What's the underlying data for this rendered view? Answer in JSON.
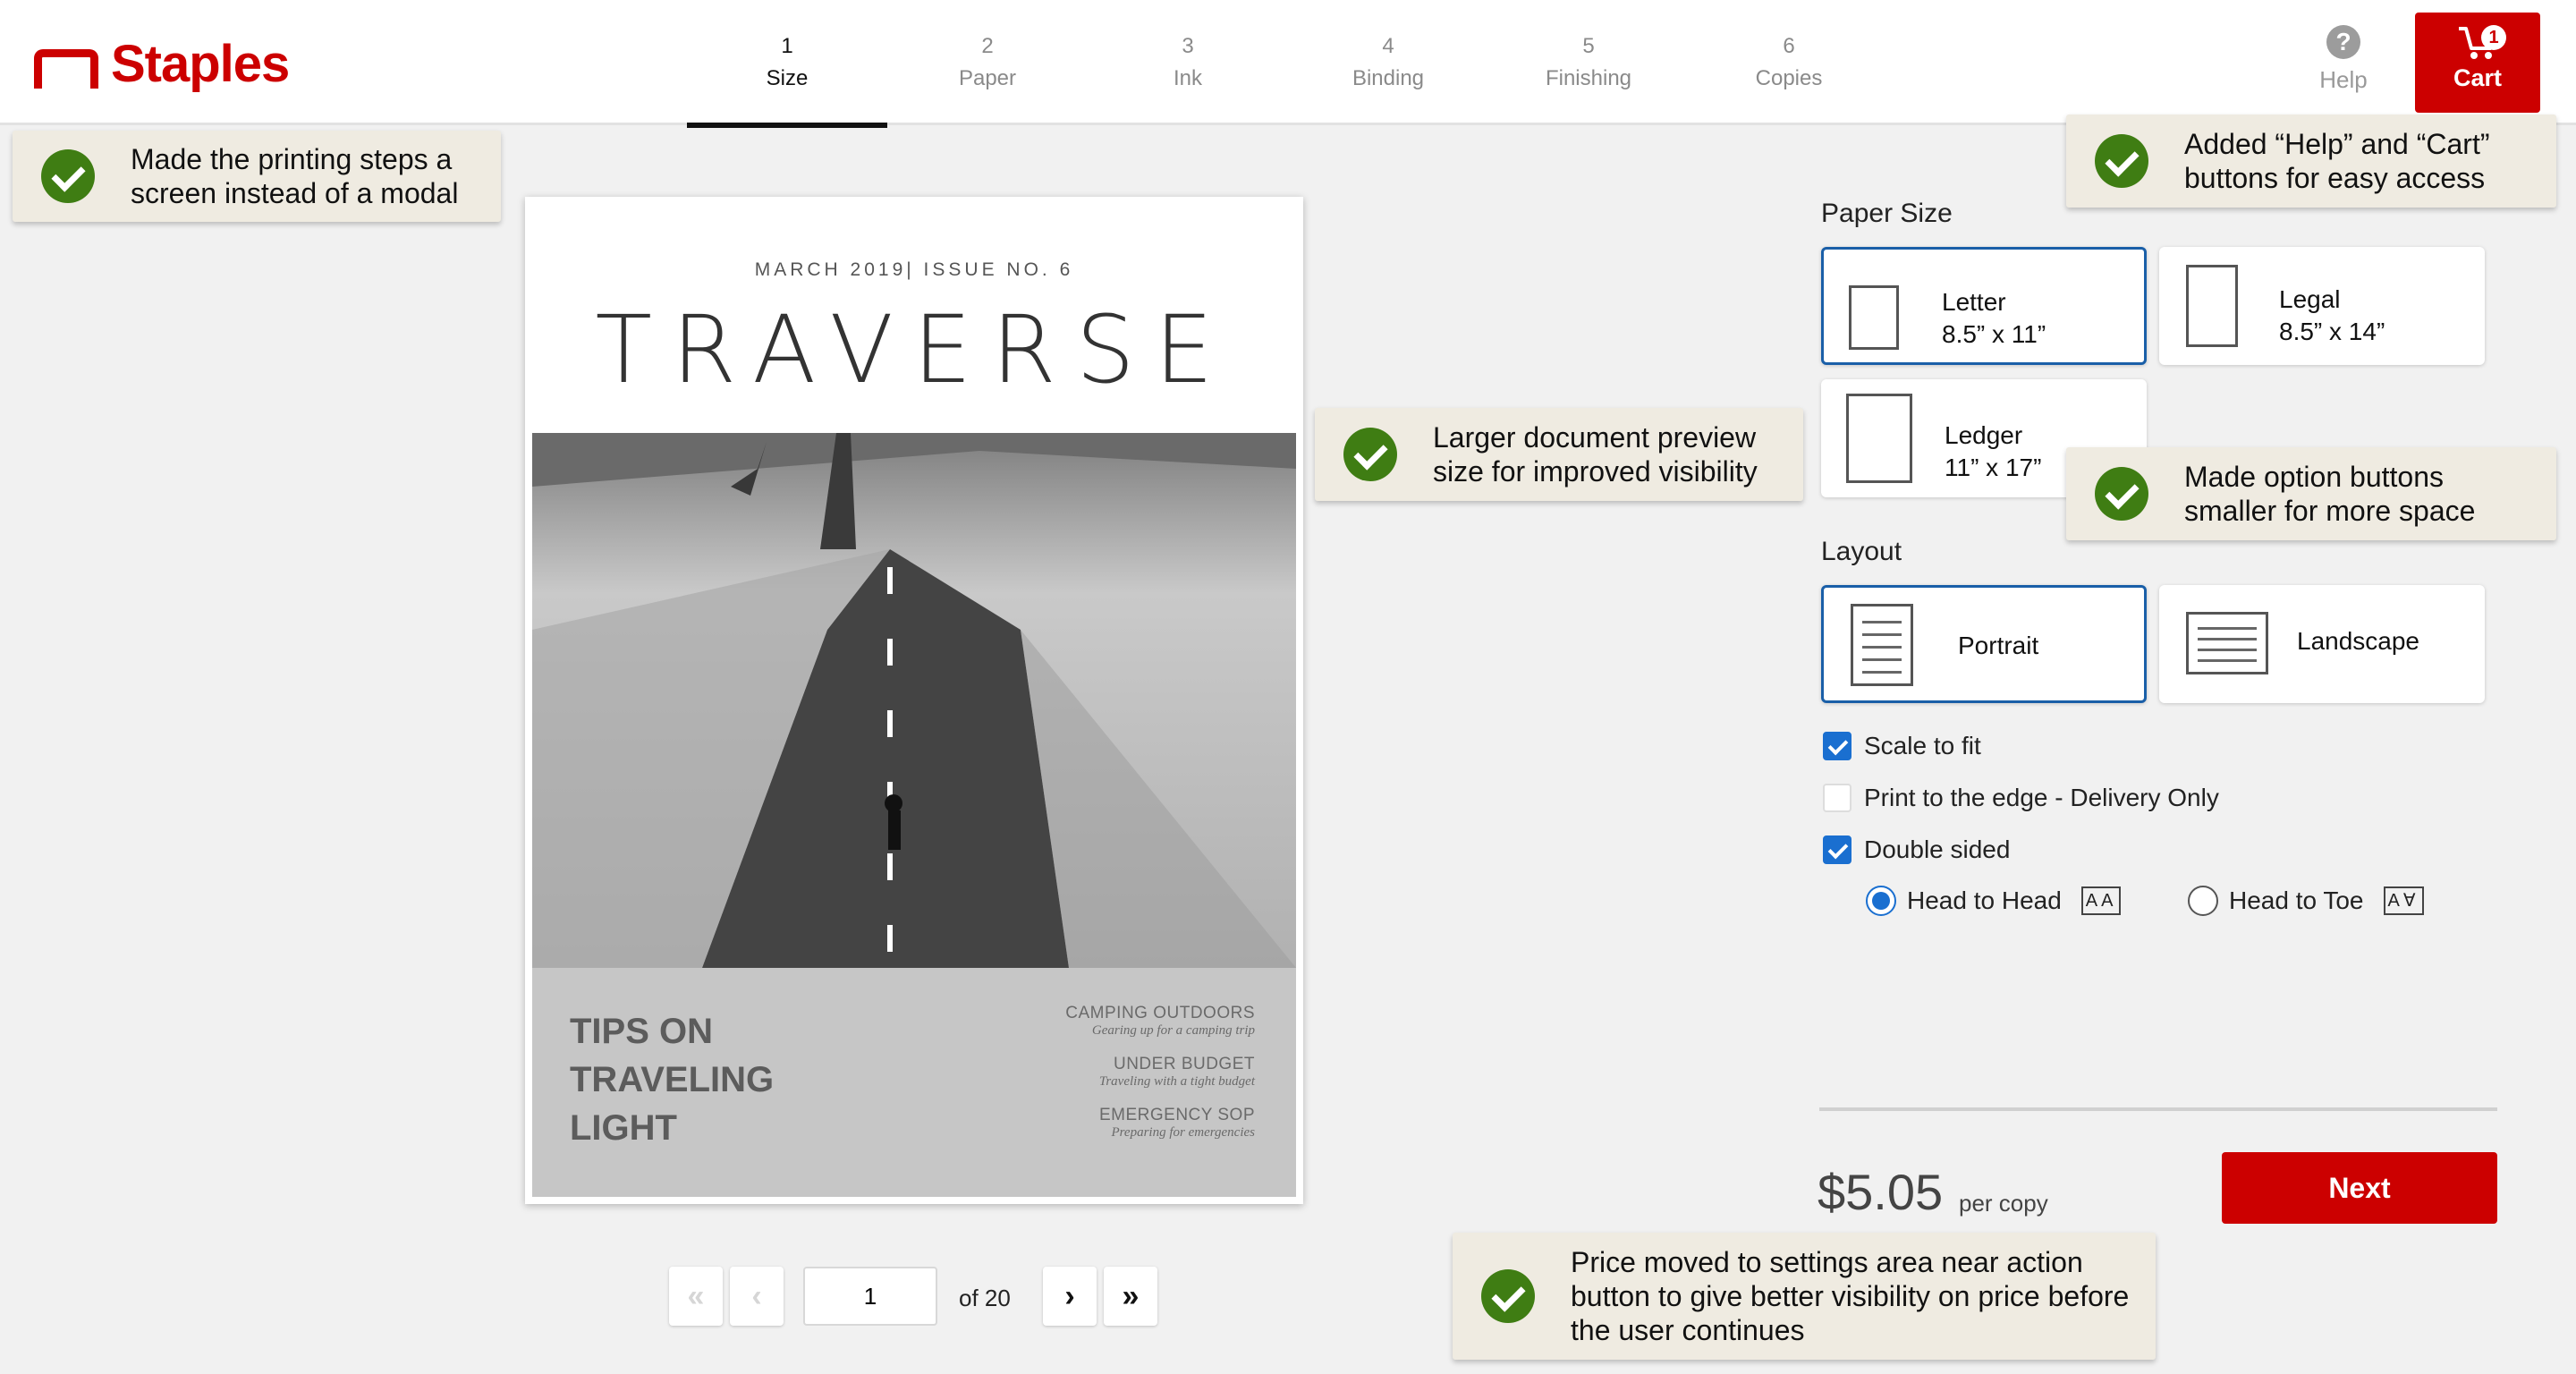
{
  "brand": {
    "name": "Staples",
    "color": "#cc0000"
  },
  "steps": [
    {
      "num": "1",
      "label": "Size"
    },
    {
      "num": "2",
      "label": "Paper"
    },
    {
      "num": "3",
      "label": "Ink"
    },
    {
      "num": "4",
      "label": "Binding"
    },
    {
      "num": "5",
      "label": "Finishing"
    },
    {
      "num": "6",
      "label": "Copies"
    }
  ],
  "header": {
    "help_label": "Help",
    "cart_label": "Cart",
    "cart_count": "1"
  },
  "notes": {
    "steps": "Made the printing steps a screen instead of a modal",
    "header_buttons": "Added “Help” and “Cart” buttons for easy access",
    "preview": "Larger document preview size for improved visibility",
    "options": "Made option buttons smaller for more space",
    "price": "Price moved to settings area near action button to give better visibility on price before the user continues"
  },
  "document": {
    "issue": "MARCH 2019| ISSUE NO. 6",
    "masthead": "TRAVERSE",
    "headline": [
      "TIPS ON",
      "TRAVELING",
      "LIGHT"
    ],
    "toc": [
      {
        "heading": "CAMPING OUTDOORS",
        "sub": "Gearing up for a camping trip"
      },
      {
        "heading": "UNDER BUDGET",
        "sub": "Traveling with a tight budget"
      },
      {
        "heading": "EMERGENCY SOP",
        "sub": "Preparing for emergencies"
      }
    ]
  },
  "pager": {
    "current": "1",
    "total_label": "of 20"
  },
  "settings": {
    "paper_size_title": "Paper Size",
    "paper_sizes": [
      {
        "name": "Letter",
        "dims": "8.5” x 11”",
        "selected": true
      },
      {
        "name": "Legal",
        "dims": "8.5” x 14”",
        "selected": false
      },
      {
        "name": "Ledger",
        "dims": "11” x 17”",
        "selected": false
      }
    ],
    "layout_title": "Layout",
    "layouts": [
      {
        "name": "Portrait",
        "selected": true
      },
      {
        "name": "Landscape",
        "selected": false
      }
    ],
    "checkboxes": [
      {
        "label": "Scale to fit",
        "checked": true
      },
      {
        "label": "Print to the edge - Delivery Only",
        "checked": false
      },
      {
        "label": "Double sided",
        "checked": true
      }
    ],
    "radios": [
      {
        "label": "Head to Head",
        "icon": "AA",
        "selected": true
      },
      {
        "label": "Head to Toe",
        "icon": "A∀",
        "selected": false
      }
    ]
  },
  "price": {
    "amount": "$5.05",
    "unit": "per copy"
  },
  "next_label": "Next",
  "accent_colors": {
    "primary": "#cc0000",
    "selection": "#1a5fa8",
    "check": "#3f7d13"
  }
}
